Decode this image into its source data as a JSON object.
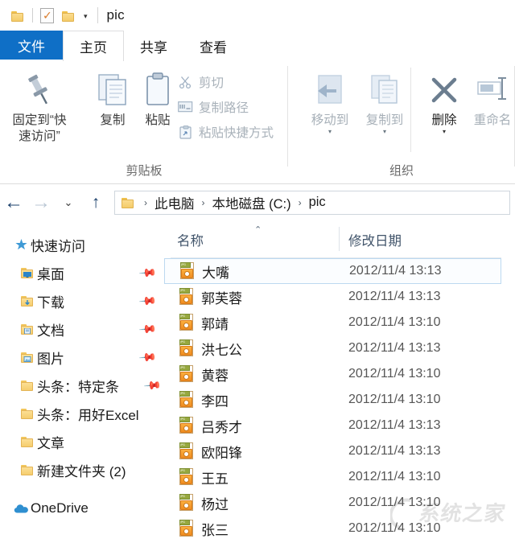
{
  "window": {
    "title": "pic",
    "quick_access": [
      {
        "name": "folder-icon",
        "label": ""
      },
      {
        "name": "properties-icon",
        "label": ""
      },
      {
        "name": "new-folder-icon",
        "label": ""
      }
    ],
    "customize_caret": "▾"
  },
  "tabs": [
    {
      "id": "file",
      "label": "文件",
      "active": false,
      "style": "blue"
    },
    {
      "id": "home",
      "label": "主页",
      "active": true
    },
    {
      "id": "share",
      "label": "共享",
      "active": false
    },
    {
      "id": "view",
      "label": "查看",
      "active": false
    }
  ],
  "ribbon": {
    "groups": [
      {
        "id": "clipboard",
        "label": "剪贴板",
        "big_buttons": [
          {
            "id": "pin-to-quick-access",
            "label": "固定到“快\n速访问”",
            "label_line1": "固定到“快",
            "label_line2": "速访问”",
            "icon": "pin-icon",
            "disabled": false
          },
          {
            "id": "copy",
            "label": "复制",
            "icon": "copy-icon",
            "disabled": false
          },
          {
            "id": "paste",
            "label": "粘贴",
            "icon": "paste-icon",
            "disabled": false
          }
        ],
        "small_buttons": [
          {
            "id": "cut",
            "label": "剪切",
            "icon": "scissors-icon",
            "disabled": true
          },
          {
            "id": "copy-path",
            "label": "复制路径",
            "icon": "copy-path-icon",
            "disabled": true
          },
          {
            "id": "paste-shortcut",
            "label": "粘贴快捷方式",
            "icon": "paste-shortcut-icon",
            "disabled": true
          }
        ]
      },
      {
        "id": "organize",
        "label": "组织",
        "big_buttons": [
          {
            "id": "move-to",
            "label": "移动到",
            "icon": "move-to-icon",
            "disabled": true,
            "caret": "▾"
          },
          {
            "id": "copy-to",
            "label": "复制到",
            "icon": "copy-to-icon",
            "disabled": true,
            "caret": "▾"
          },
          {
            "id": "delete",
            "label": "删除",
            "icon": "delete-x-icon",
            "disabled": false,
            "caret": "▾"
          },
          {
            "id": "rename",
            "label": "重命名",
            "icon": "rename-icon",
            "disabled": true
          }
        ]
      }
    ]
  },
  "addressbar": {
    "back": "←",
    "forward": "→",
    "recent": "⌄",
    "up": "↑",
    "folder_icon": "folder-icon",
    "crumbs": [
      "此电脑",
      "本地磁盘 (C:)",
      "pic"
    ],
    "separator": "›"
  },
  "sidebar": {
    "items": [
      {
        "id": "quick-access",
        "label": "快速访问",
        "icon": "star-pin-icon",
        "root": true,
        "pinned": false
      },
      {
        "id": "desktop",
        "label": "桌面",
        "icon": "desktop-folder-icon",
        "root": false,
        "pinned": true
      },
      {
        "id": "downloads",
        "label": "下载",
        "icon": "downloads-folder-icon",
        "root": false,
        "pinned": true
      },
      {
        "id": "documents",
        "label": "文档",
        "icon": "documents-folder-icon",
        "root": false,
        "pinned": true
      },
      {
        "id": "pictures",
        "label": "图片",
        "icon": "pictures-folder-icon",
        "root": false,
        "pinned": true
      },
      {
        "id": "toutiao-teding",
        "label": "头条：特定条",
        "icon": "folder-icon",
        "root": false,
        "pinned": true
      },
      {
        "id": "toutiao-excel",
        "label": "头条：用好Excel",
        "icon": "folder-icon",
        "root": false,
        "pinned": false
      },
      {
        "id": "articles",
        "label": "文章",
        "icon": "folder-icon",
        "root": false,
        "pinned": false
      },
      {
        "id": "new-folder-2",
        "label": "新建文件夹 (2)",
        "icon": "folder-icon",
        "root": false,
        "pinned": false
      },
      {
        "id": "onedrive",
        "label": "OneDrive",
        "icon": "cloud-icon",
        "root": true,
        "pinned": false
      }
    ],
    "pin_glyph": "📌",
    "scroll_up_glyph": "⌃"
  },
  "filelist": {
    "columns": [
      {
        "id": "name",
        "label": "名称",
        "sorted": true,
        "sort_glyph": "⌃"
      },
      {
        "id": "modified",
        "label": "修改日期",
        "sorted": false
      }
    ],
    "rows": [
      {
        "name": "大嘴",
        "modified": "2012/11/4 13:13",
        "icon": "jpg-file-icon",
        "selected": true
      },
      {
        "name": "郭芙蓉",
        "modified": "2012/11/4 13:13",
        "icon": "jpg-file-icon",
        "selected": false
      },
      {
        "name": "郭靖",
        "modified": "2012/11/4 13:10",
        "icon": "jpg-file-icon",
        "selected": false
      },
      {
        "name": "洪七公",
        "modified": "2012/11/4 13:13",
        "icon": "jpg-file-icon",
        "selected": false
      },
      {
        "name": "黄蓉",
        "modified": "2012/11/4 13:10",
        "icon": "jpg-file-icon",
        "selected": false
      },
      {
        "name": "李四",
        "modified": "2012/11/4 13:10",
        "icon": "jpg-file-icon",
        "selected": false
      },
      {
        "name": "吕秀才",
        "modified": "2012/11/4 13:13",
        "icon": "jpg-file-icon",
        "selected": false
      },
      {
        "name": "欧阳锋",
        "modified": "2012/11/4 13:13",
        "icon": "jpg-file-icon",
        "selected": false
      },
      {
        "name": "王五",
        "modified": "2012/11/4 13:10",
        "icon": "jpg-file-icon",
        "selected": false
      },
      {
        "name": "杨过",
        "modified": "2012/11/4 13:10",
        "icon": "jpg-file-icon",
        "selected": false
      },
      {
        "name": "张三",
        "modified": "2012/11/4 13:10",
        "icon": "jpg-file-icon",
        "selected": false
      }
    ]
  },
  "watermark": {
    "text": "系统之家"
  },
  "colors": {
    "accent": "#0f6fc6",
    "selection_border": "#bcd9f0",
    "header_text": "#42556b",
    "folder_yellow": "#f4cb6a",
    "jpg_orange": "#ef8c20"
  }
}
